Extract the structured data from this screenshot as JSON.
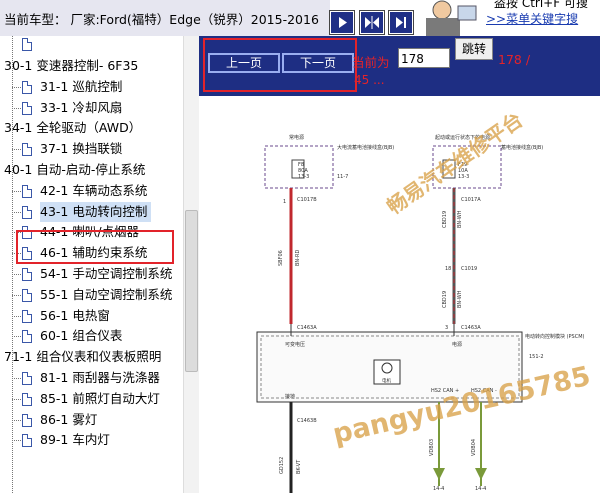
{
  "header": {
    "car_title": "当前车型： 厂家:Ford(福特）Edge（锐界）2015-2016",
    "hint_line1": "盗按 Ctrl+F  可搜",
    "hint_link": ">>菜单关键字搜"
  },
  "tree": {
    "top_partial": "30-1 变速器控制",
    "rows": [
      {
        "type": "cat",
        "label": "30-1 变速器控制- 6F35"
      },
      {
        "type": "item",
        "label": "31-1 巡航控制"
      },
      {
        "type": "item",
        "label": "33-1 冷却风扇"
      },
      {
        "type": "cat",
        "label": "34-1 全轮驱动（AWD）"
      },
      {
        "type": "item",
        "label": "37-1 换挡联锁"
      },
      {
        "type": "cat",
        "label": "40-1 自动-启动-停止系统"
      },
      {
        "type": "item",
        "label": "42-1 车辆动态系统"
      },
      {
        "type": "item",
        "label": "43-1 电动转向控制",
        "selected": true
      },
      {
        "type": "item",
        "label": "44-1 喇叭/点烟器"
      },
      {
        "type": "item",
        "label": "46-1 辅助约束系统"
      },
      {
        "type": "item",
        "label": "54-1 手动空调控制系统"
      },
      {
        "type": "item",
        "label": "55-1 自动空调控制系统"
      },
      {
        "type": "item",
        "label": "56-1 电热窗"
      },
      {
        "type": "item",
        "label": "60-1 组合仪表"
      },
      {
        "type": "cat",
        "label": "71-1 组合仪表和仪表板照明"
      },
      {
        "type": "item",
        "label": "81-1 雨刮器与洗涤器"
      },
      {
        "type": "item",
        "label": "85-1 前照灯自动大灯"
      },
      {
        "type": "item",
        "label": "86-1 雾灯"
      },
      {
        "type": "item",
        "label": "89-1 车内灯"
      }
    ]
  },
  "nav": {
    "prev_label": "上一页",
    "next_label": "下一页",
    "page_label": "当前为",
    "page_value": "178",
    "jump_label": "跳转",
    "total_prefix": "178 /",
    "total_suffix": "45 ..."
  },
  "diagram": {
    "hot_label_left": "常电源",
    "fuse_box_left": "大电流蓄电池接线盒(BJB)",
    "fuse_left": "F8",
    "fuse_left_amp": "80A",
    "fuse_left_ref": "13-3",
    "ref_left": "11-7",
    "hot_label_right": "起动或运行状态下的电源",
    "fuse_box_right": "蓄电池接线盒(BJB)",
    "fuse_right": "F19",
    "fuse_right_amp": "10A",
    "fuse_right_ref": "13-3",
    "conn_left": "C1017B",
    "conn_right_top": "C1017A",
    "conn_mid": "C1019",
    "wire_left_id": "SBF06",
    "wire_left_color": "BN-RD",
    "wire_right_id": "CBD19",
    "wire_right_color": "BN-WH",
    "wire_right_id2": "CBD19",
    "wire_right_color2": "BN-WH",
    "pin_1": "1",
    "pin_18": "18",
    "pin_3": "3",
    "conn_pscm_left": "C1463A",
    "conn_pscm_right": "C1463A",
    "module_label": "电动转向控制模块\n(PSCM)",
    "module_ref": "151-2",
    "battery_label": "可变电压",
    "power_label": "电源",
    "motor_label": "电机",
    "ground_label": "接地",
    "hs2_plus": "HS2 CAN +",
    "hs2_minus": "HS2 CAN -",
    "conn_bottom": "C1463B",
    "wire_bot_left_id": "GD152",
    "wire_bot_left_color": "BK-VT",
    "wire_bot_mid_id": "VDB03",
    "wire_bot_right_id": "VDB04",
    "ref_bottom_left": "14-4",
    "ref_bottom_right": "14-4"
  },
  "watermarks": {
    "platform": "畅易汽车维修平台",
    "contact": "pangyu20165785"
  },
  "colors": {
    "nav_blue": "#1e2e83",
    "highlight_red": "#e2232a",
    "watermark": "#d9a24a",
    "wire_red": "#c0282e",
    "wire_gray": "#555"
  }
}
